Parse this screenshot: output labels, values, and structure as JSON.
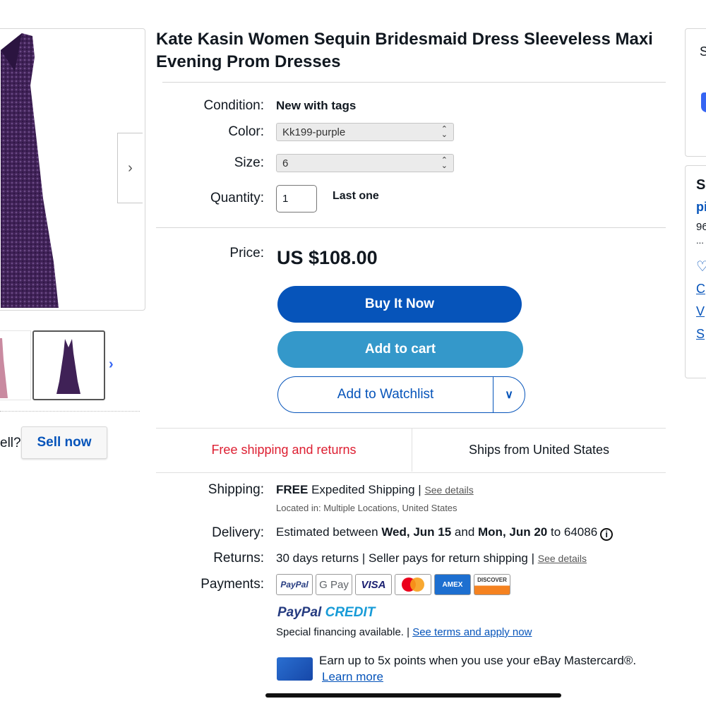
{
  "product": {
    "title": "Kate Kasin Women Sequin Bridesmaid Dress Sleeveless Maxi Evening Prom Dresses"
  },
  "gallery": {
    "next_arrow": "›",
    "thumb_next_arrow": "›"
  },
  "sell": {
    "question_fragment": "ell?",
    "button_label": "Sell now"
  },
  "details": {
    "condition_label": "Condition:",
    "condition_value": "New with tags",
    "color_label": "Color:",
    "color_value": "Kk199-purple",
    "size_label": "Size:",
    "size_value": "6",
    "quantity_label": "Quantity:",
    "quantity_value": "1",
    "stock_note": "Last one"
  },
  "pricing": {
    "price_label": "Price:",
    "price_value": "US $108.00"
  },
  "actions": {
    "buy_now": "Buy It Now",
    "add_to_cart": "Add to cart",
    "add_to_watchlist": "Add to Watchlist"
  },
  "shipping_strip": {
    "free": "Free shipping and returns",
    "ships_from": "Ships from United States"
  },
  "shipping": {
    "label": "Shipping:",
    "free_word": "FREE",
    "method": " Expedited Shipping | ",
    "see_details": "See details",
    "located": "Located in: Multiple Locations, United States"
  },
  "delivery": {
    "label": "Delivery:",
    "text_1": "Estimated between ",
    "date_1": "Wed, Jun 15",
    "text_2": " and ",
    "date_2": "Mon, Jun 20",
    "text_3": " to 64086",
    "info_icon": "i"
  },
  "returns": {
    "label": "Returns:",
    "text": "30 days returns | Seller pays for return shipping | ",
    "see_details": "See details"
  },
  "payments": {
    "label": "Payments:",
    "methods": [
      "PayPal",
      "G Pay",
      "VISA",
      "",
      "AMEX",
      "DISCOVER"
    ],
    "paypal_credit_1": "PayPal",
    "paypal_credit_2": " CREDIT",
    "special": "Special financing available. | ",
    "special_link": "See terms and apply now"
  },
  "promo": {
    "earn": "Earn up to 5x points when you use your eBay Mastercard®.",
    "learn_more": "Learn more"
  },
  "right_panel": {
    "panel1_letter": "S",
    "panel2_heading": "S",
    "panel2_link": "pi",
    "panel2_count": "96",
    "panel2_dots": "...",
    "panel2_item_1": "C",
    "panel2_item_2": "V",
    "panel2_item_3": "S"
  },
  "colors": {
    "primary_blue": "#0654ba",
    "cart_blue": "#3498ca",
    "free_red": "#dd1e31",
    "dress_purple": "#4a2a5e"
  }
}
